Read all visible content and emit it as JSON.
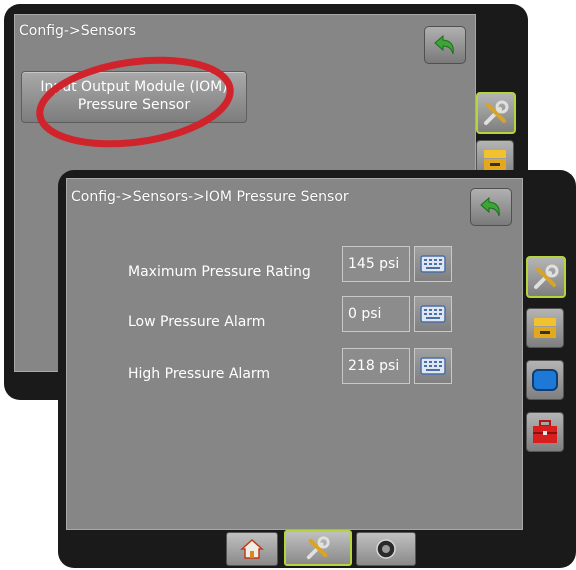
{
  "back_screen": {
    "breadcrumb": "Config->Sensors",
    "button_label_line1": "Input Output Module (IOM)",
    "button_label_line2": "Pressure Sensor"
  },
  "front_screen": {
    "breadcrumb": "Config->Sensors->IOM Pressure Sensor",
    "rows": [
      {
        "label": "Maximum Pressure Rating",
        "value": "145 psi"
      },
      {
        "label": "Low Pressure Alarm",
        "value": "0 psi"
      },
      {
        "label": "High Pressure Alarm",
        "value": "218 psi"
      }
    ]
  },
  "side_tabs": [
    "tools-icon",
    "console-icon",
    "display-icon",
    "toolbox-icon"
  ],
  "bottom_tabs": [
    "home-icon",
    "tools-icon",
    "camera-icon"
  ],
  "colors": {
    "panel": "#868686",
    "active_highlight": "#b5d63a",
    "annotation_circle": "#d0232b",
    "back_arrow": "#3aa635"
  }
}
